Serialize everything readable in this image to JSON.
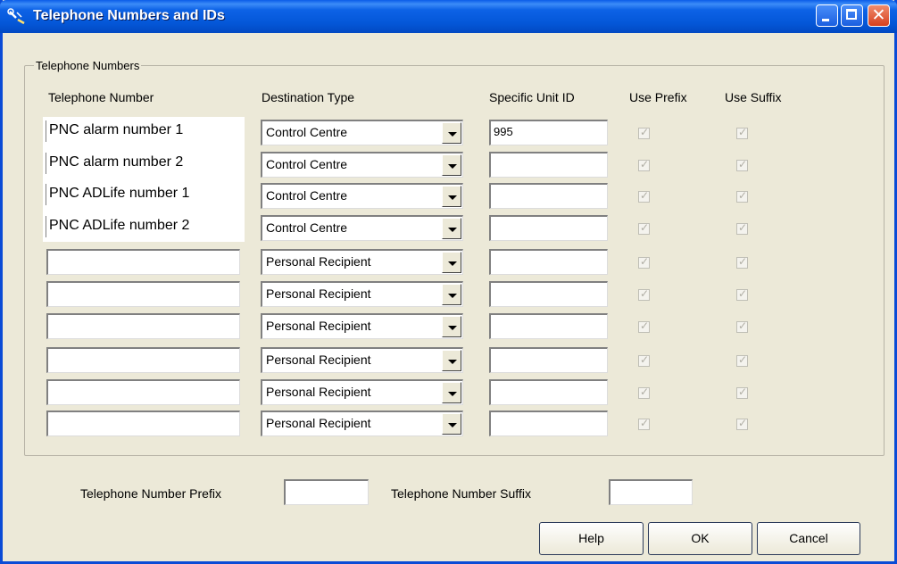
{
  "window": {
    "title": "Telephone Numbers and IDs"
  },
  "group": {
    "legend": "Telephone Numbers"
  },
  "headers": {
    "telephone_number": "Telephone Number",
    "destination_type": "Destination Type",
    "specific_unit_id": "Specific Unit ID",
    "use_prefix": "Use Prefix",
    "use_suffix": "Use Suffix"
  },
  "rows": [
    {
      "telephone_number": "PNC alarm number 1",
      "destination_type": "Control Centre",
      "unit_id": "995",
      "use_prefix": true,
      "use_suffix": true
    },
    {
      "telephone_number": "PNC alarm number 2",
      "destination_type": "Control Centre",
      "unit_id": "",
      "use_prefix": true,
      "use_suffix": true
    },
    {
      "telephone_number": "PNC ADLife number 1",
      "destination_type": "Control Centre",
      "unit_id": "",
      "use_prefix": true,
      "use_suffix": true
    },
    {
      "telephone_number": "PNC ADLife number 2",
      "destination_type": "Control Centre",
      "unit_id": "",
      "use_prefix": true,
      "use_suffix": true
    },
    {
      "telephone_number": "",
      "destination_type": "Personal Recipient",
      "unit_id": "",
      "use_prefix": true,
      "use_suffix": true
    },
    {
      "telephone_number": "",
      "destination_type": "Personal Recipient",
      "unit_id": "",
      "use_prefix": true,
      "use_suffix": true
    },
    {
      "telephone_number": "",
      "destination_type": "Personal Recipient",
      "unit_id": "",
      "use_prefix": true,
      "use_suffix": true
    },
    {
      "telephone_number": "",
      "destination_type": "Personal Recipient",
      "unit_id": "",
      "use_prefix": true,
      "use_suffix": true
    },
    {
      "telephone_number": "",
      "destination_type": "Personal Recipient",
      "unit_id": "",
      "use_prefix": true,
      "use_suffix": true
    },
    {
      "telephone_number": "",
      "destination_type": "Personal Recipient",
      "unit_id": "",
      "use_prefix": true,
      "use_suffix": true
    }
  ],
  "bottom": {
    "prefix_label": "Telephone Number Prefix",
    "prefix_value": "",
    "suffix_label": "Telephone Number Suffix",
    "suffix_value": ""
  },
  "buttons": {
    "help": "Help",
    "ok": "OK",
    "cancel": "Cancel"
  },
  "icons": {
    "title": "tools-icon",
    "minimize": "minimize-icon",
    "maximize": "maximize-icon",
    "close": "close-icon",
    "dropdown": "chevron-down-icon",
    "checkbox": "checkmark-icon"
  }
}
